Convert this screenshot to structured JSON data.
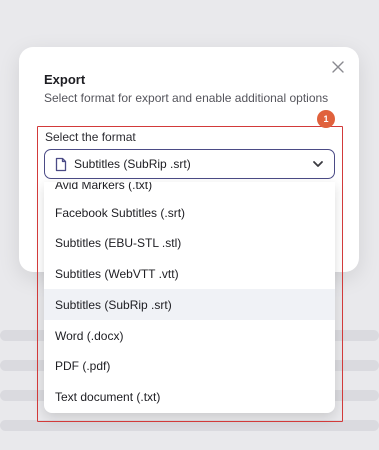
{
  "dialog": {
    "title": "Export",
    "subtitle": "Select format for export and enable additional options"
  },
  "marker": {
    "label": "1"
  },
  "format_field": {
    "label": "Select the format",
    "selected_value": "Subtitles (SubRip .srt)"
  },
  "dropdown": {
    "options": [
      "Avid Markers (.txt)",
      "Facebook Subtitles (.srt)",
      "Subtitles (EBU-STL .stl)",
      "Subtitles (WebVTT .vtt)",
      "Subtitles (SubRip .srt)",
      "Word (.docx)",
      "PDF (.pdf)",
      "Text document (.txt)"
    ],
    "selected_index": 4
  },
  "colors": {
    "highlight": "#d23a3a",
    "marker": "#e0613c",
    "select_border": "#4b4b86",
    "selected_row": "#f0f2f6"
  },
  "icons": [
    "close-icon",
    "document-icon",
    "chevron-down-icon"
  ]
}
